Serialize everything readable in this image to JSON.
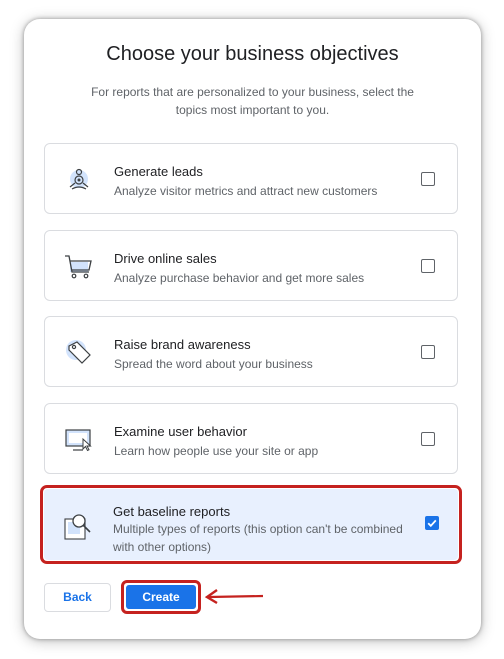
{
  "title": "Choose your business objectives",
  "subtitle": "For reports that are personalized to your business, select the topics most important to you.",
  "options": [
    {
      "label": "Generate leads",
      "desc": "Analyze visitor metrics and attract new customers",
      "checked": false,
      "icon": "people-target-icon"
    },
    {
      "label": "Drive online sales",
      "desc": "Analyze purchase behavior and get more sales",
      "checked": false,
      "icon": "shopping-cart-icon"
    },
    {
      "label": "Raise brand awareness",
      "desc": "Spread the word about your business",
      "checked": false,
      "icon": "tag-icon"
    },
    {
      "label": "Examine user behavior",
      "desc": "Learn how people use your site or app",
      "checked": false,
      "icon": "screen-cursor-icon"
    },
    {
      "label": "Get baseline reports",
      "desc": "Multiple types of reports (this option can't be combined with other options)",
      "checked": true,
      "icon": "magnifier-report-icon"
    }
  ],
  "buttons": {
    "back": "Back",
    "create": "Create"
  },
  "colors": {
    "accent": "#1a73e8",
    "highlight": "#c5221f",
    "selected_bg": "#e8f0fe"
  }
}
